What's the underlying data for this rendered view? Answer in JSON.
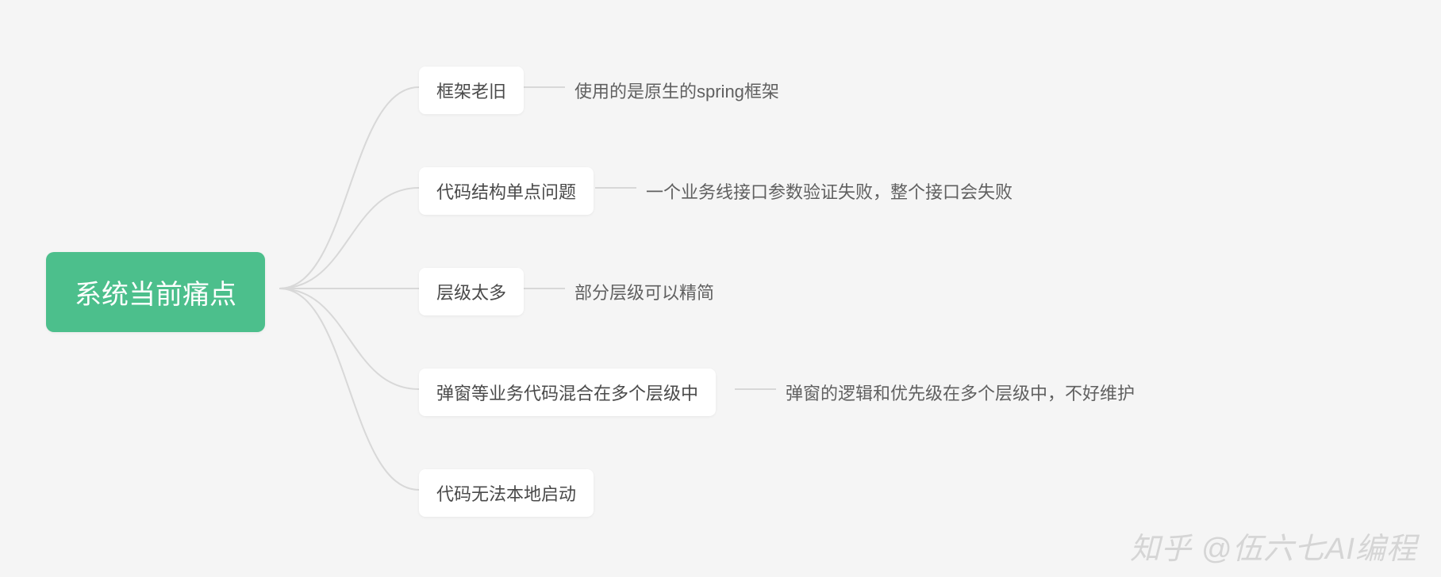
{
  "root": {
    "label": "系统当前痛点"
  },
  "branches": [
    {
      "label": "框架老旧",
      "detail": "使用的是原生的spring框架"
    },
    {
      "label": "代码结构单点问题",
      "detail": "一个业务线接口参数验证失败，整个接口会失败"
    },
    {
      "label": "层级太多",
      "detail": "部分层级可以精简"
    },
    {
      "label": "弹窗等业务代码混合在多个层级中",
      "detail": "弹窗的逻辑和优先级在多个层级中，不好维护"
    },
    {
      "label": "代码无法本地启动",
      "detail": ""
    }
  ],
  "watermark": "知乎 @伍六七AI编程",
  "colors": {
    "root_bg": "#4cbf8c",
    "node_bg": "#ffffff",
    "connector": "#d8d8d8",
    "page_bg": "#f5f5f5"
  }
}
